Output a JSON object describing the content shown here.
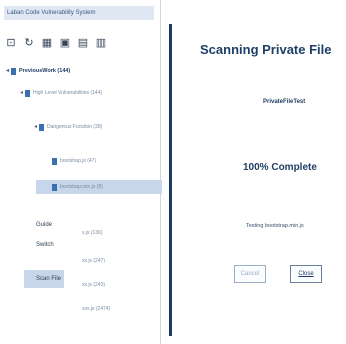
{
  "app": {
    "title": "Laban Code Vulnerability System"
  },
  "toolbar": {
    "buttons": [
      {
        "name": "open-icon",
        "glyph": "⊡"
      },
      {
        "name": "refresh-icon",
        "glyph": "↻"
      },
      {
        "name": "save-icon",
        "glyph": "▦"
      },
      {
        "name": "grid-icon",
        "glyph": "▣"
      },
      {
        "name": "report-icon",
        "glyph": "▤"
      },
      {
        "name": "export-icon",
        "glyph": "▥"
      }
    ]
  },
  "tree": {
    "root_label": "PreviousWork (144)",
    "level1_label": "High Level Vulnerabilities (144)",
    "level2_label": "Dangerous Function (28)",
    "level3_a": "bootstrap.js (47)",
    "level3_b": "bootstrap.min.js (8)",
    "lower_items": [
      "x.js (136)",
      "xx.js (247)",
      "xx.js (243)",
      "xxx.js (2474)"
    ]
  },
  "context_menu": {
    "items": [
      "Guide",
      "Switch",
      "Scan File"
    ]
  },
  "main": {
    "title": "Scanning Private File",
    "file_name": "PrivateFileTest",
    "progress_text": "100% Complete",
    "status": "Testing bootstrap.min.js"
  },
  "buttons": {
    "cancel": "Cancel",
    "close": "Close"
  },
  "colors": {
    "accent": "#1d3a64",
    "selection": "#c7d6ea",
    "title_bg": "#dfe8f3"
  }
}
